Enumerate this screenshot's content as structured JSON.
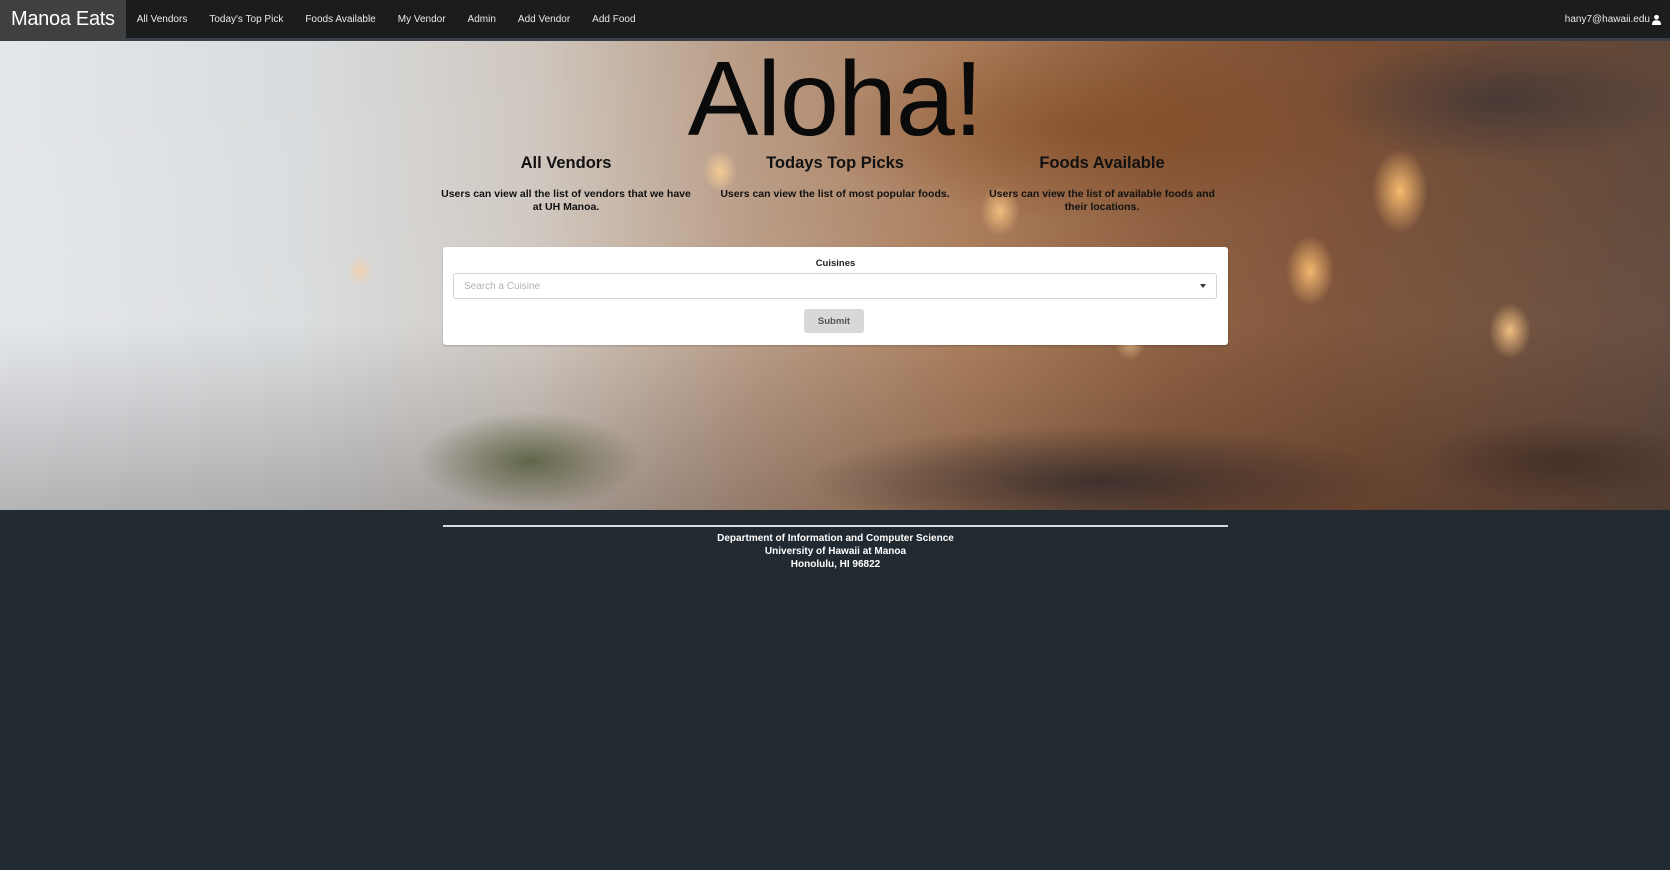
{
  "navbar": {
    "brand": "Manoa Eats",
    "items": [
      {
        "label": "All Vendors"
      },
      {
        "label": "Today's Top Pick"
      },
      {
        "label": "Foods Available"
      },
      {
        "label": "My Vendor"
      },
      {
        "label": "Admin"
      },
      {
        "label": "Add Vendor"
      },
      {
        "label": "Add Food"
      }
    ],
    "user_email": "hany7@hawaii.edu",
    "user_icon": "user-icon"
  },
  "hero": {
    "title": "Aloha!",
    "features": [
      {
        "heading": "All Vendors",
        "description": "Users can view all the list of vendors that we have at UH Manoa."
      },
      {
        "heading": "Todays Top Picks",
        "description": "Users can view the list of most popular foods."
      },
      {
        "heading": "Foods Available",
        "description": "Users can view the list of available foods and their locations."
      }
    ]
  },
  "form": {
    "label": "Cuisines",
    "select_placeholder": "Search a Cuisine",
    "submit_label": "Submit"
  },
  "footer": {
    "line1": "Department of Information and Computer Science",
    "line2": "University of Hawaii at Manoa",
    "line3": "Honolulu, HI 96822"
  }
}
